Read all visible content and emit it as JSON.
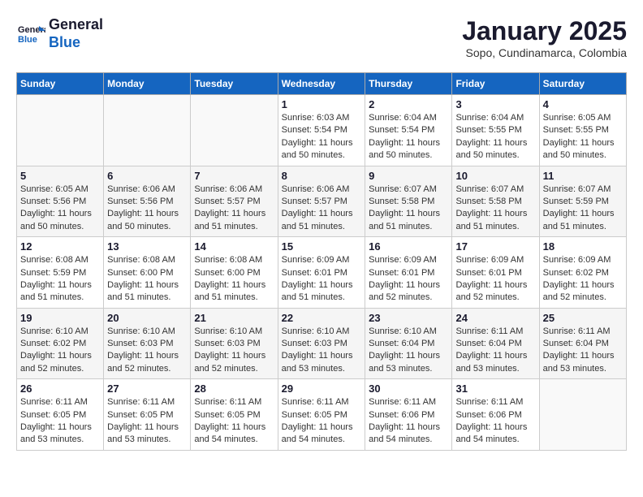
{
  "header": {
    "logo_line1": "General",
    "logo_line2": "Blue",
    "month": "January 2025",
    "location": "Sopo, Cundinamarca, Colombia"
  },
  "weekdays": [
    "Sunday",
    "Monday",
    "Tuesday",
    "Wednesday",
    "Thursday",
    "Friday",
    "Saturday"
  ],
  "weeks": [
    [
      {
        "day": "",
        "sunrise": "",
        "sunset": "",
        "daylight": ""
      },
      {
        "day": "",
        "sunrise": "",
        "sunset": "",
        "daylight": ""
      },
      {
        "day": "",
        "sunrise": "",
        "sunset": "",
        "daylight": ""
      },
      {
        "day": "1",
        "sunrise": "Sunrise: 6:03 AM",
        "sunset": "Sunset: 5:54 PM",
        "daylight": "Daylight: 11 hours and 50 minutes."
      },
      {
        "day": "2",
        "sunrise": "Sunrise: 6:04 AM",
        "sunset": "Sunset: 5:54 PM",
        "daylight": "Daylight: 11 hours and 50 minutes."
      },
      {
        "day": "3",
        "sunrise": "Sunrise: 6:04 AM",
        "sunset": "Sunset: 5:55 PM",
        "daylight": "Daylight: 11 hours and 50 minutes."
      },
      {
        "day": "4",
        "sunrise": "Sunrise: 6:05 AM",
        "sunset": "Sunset: 5:55 PM",
        "daylight": "Daylight: 11 hours and 50 minutes."
      }
    ],
    [
      {
        "day": "5",
        "sunrise": "Sunrise: 6:05 AM",
        "sunset": "Sunset: 5:56 PM",
        "daylight": "Daylight: 11 hours and 50 minutes."
      },
      {
        "day": "6",
        "sunrise": "Sunrise: 6:06 AM",
        "sunset": "Sunset: 5:56 PM",
        "daylight": "Daylight: 11 hours and 50 minutes."
      },
      {
        "day": "7",
        "sunrise": "Sunrise: 6:06 AM",
        "sunset": "Sunset: 5:57 PM",
        "daylight": "Daylight: 11 hours and 51 minutes."
      },
      {
        "day": "8",
        "sunrise": "Sunrise: 6:06 AM",
        "sunset": "Sunset: 5:57 PM",
        "daylight": "Daylight: 11 hours and 51 minutes."
      },
      {
        "day": "9",
        "sunrise": "Sunrise: 6:07 AM",
        "sunset": "Sunset: 5:58 PM",
        "daylight": "Daylight: 11 hours and 51 minutes."
      },
      {
        "day": "10",
        "sunrise": "Sunrise: 6:07 AM",
        "sunset": "Sunset: 5:58 PM",
        "daylight": "Daylight: 11 hours and 51 minutes."
      },
      {
        "day": "11",
        "sunrise": "Sunrise: 6:07 AM",
        "sunset": "Sunset: 5:59 PM",
        "daylight": "Daylight: 11 hours and 51 minutes."
      }
    ],
    [
      {
        "day": "12",
        "sunrise": "Sunrise: 6:08 AM",
        "sunset": "Sunset: 5:59 PM",
        "daylight": "Daylight: 11 hours and 51 minutes."
      },
      {
        "day": "13",
        "sunrise": "Sunrise: 6:08 AM",
        "sunset": "Sunset: 6:00 PM",
        "daylight": "Daylight: 11 hours and 51 minutes."
      },
      {
        "day": "14",
        "sunrise": "Sunrise: 6:08 AM",
        "sunset": "Sunset: 6:00 PM",
        "daylight": "Daylight: 11 hours and 51 minutes."
      },
      {
        "day": "15",
        "sunrise": "Sunrise: 6:09 AM",
        "sunset": "Sunset: 6:01 PM",
        "daylight": "Daylight: 11 hours and 51 minutes."
      },
      {
        "day": "16",
        "sunrise": "Sunrise: 6:09 AM",
        "sunset": "Sunset: 6:01 PM",
        "daylight": "Daylight: 11 hours and 52 minutes."
      },
      {
        "day": "17",
        "sunrise": "Sunrise: 6:09 AM",
        "sunset": "Sunset: 6:01 PM",
        "daylight": "Daylight: 11 hours and 52 minutes."
      },
      {
        "day": "18",
        "sunrise": "Sunrise: 6:09 AM",
        "sunset": "Sunset: 6:02 PM",
        "daylight": "Daylight: 11 hours and 52 minutes."
      }
    ],
    [
      {
        "day": "19",
        "sunrise": "Sunrise: 6:10 AM",
        "sunset": "Sunset: 6:02 PM",
        "daylight": "Daylight: 11 hours and 52 minutes."
      },
      {
        "day": "20",
        "sunrise": "Sunrise: 6:10 AM",
        "sunset": "Sunset: 6:03 PM",
        "daylight": "Daylight: 11 hours and 52 minutes."
      },
      {
        "day": "21",
        "sunrise": "Sunrise: 6:10 AM",
        "sunset": "Sunset: 6:03 PM",
        "daylight": "Daylight: 11 hours and 52 minutes."
      },
      {
        "day": "22",
        "sunrise": "Sunrise: 6:10 AM",
        "sunset": "Sunset: 6:03 PM",
        "daylight": "Daylight: 11 hours and 53 minutes."
      },
      {
        "day": "23",
        "sunrise": "Sunrise: 6:10 AM",
        "sunset": "Sunset: 6:04 PM",
        "daylight": "Daylight: 11 hours and 53 minutes."
      },
      {
        "day": "24",
        "sunrise": "Sunrise: 6:11 AM",
        "sunset": "Sunset: 6:04 PM",
        "daylight": "Daylight: 11 hours and 53 minutes."
      },
      {
        "day": "25",
        "sunrise": "Sunrise: 6:11 AM",
        "sunset": "Sunset: 6:04 PM",
        "daylight": "Daylight: 11 hours and 53 minutes."
      }
    ],
    [
      {
        "day": "26",
        "sunrise": "Sunrise: 6:11 AM",
        "sunset": "Sunset: 6:05 PM",
        "daylight": "Daylight: 11 hours and 53 minutes."
      },
      {
        "day": "27",
        "sunrise": "Sunrise: 6:11 AM",
        "sunset": "Sunset: 6:05 PM",
        "daylight": "Daylight: 11 hours and 53 minutes."
      },
      {
        "day": "28",
        "sunrise": "Sunrise: 6:11 AM",
        "sunset": "Sunset: 6:05 PM",
        "daylight": "Daylight: 11 hours and 54 minutes."
      },
      {
        "day": "29",
        "sunrise": "Sunrise: 6:11 AM",
        "sunset": "Sunset: 6:05 PM",
        "daylight": "Daylight: 11 hours and 54 minutes."
      },
      {
        "day": "30",
        "sunrise": "Sunrise: 6:11 AM",
        "sunset": "Sunset: 6:06 PM",
        "daylight": "Daylight: 11 hours and 54 minutes."
      },
      {
        "day": "31",
        "sunrise": "Sunrise: 6:11 AM",
        "sunset": "Sunset: 6:06 PM",
        "daylight": "Daylight: 11 hours and 54 minutes."
      },
      {
        "day": "",
        "sunrise": "",
        "sunset": "",
        "daylight": ""
      }
    ]
  ]
}
